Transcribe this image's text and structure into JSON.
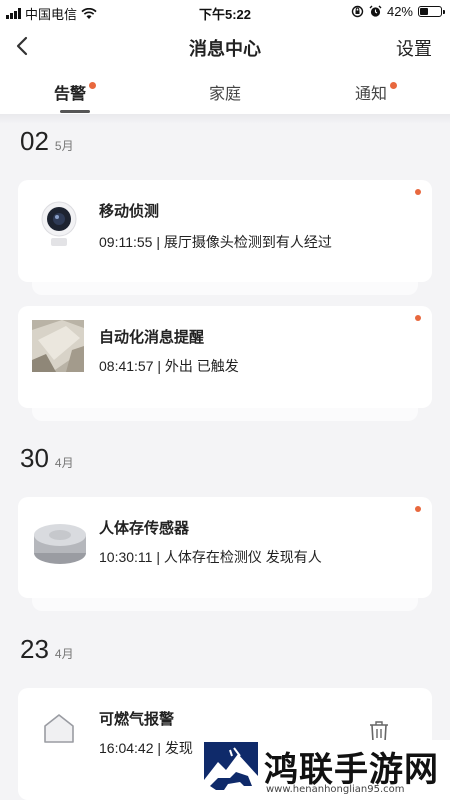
{
  "status_bar": {
    "carrier": "中国电信",
    "time": "下午5:22",
    "battery": "42%",
    "battery_level": 0.42,
    "icons": [
      "signal-icon",
      "wifi-icon",
      "orientation-lock-icon",
      "alarm-icon",
      "battery-icon"
    ]
  },
  "nav": {
    "title": "消息中心",
    "settings_label": "设置",
    "back_icon": "chevron-left-icon"
  },
  "tabs": [
    {
      "label": "告警",
      "active": true,
      "unread": true
    },
    {
      "label": "家庭",
      "active": false,
      "unread": false
    },
    {
      "label": "通知",
      "active": false,
      "unread": true
    }
  ],
  "groups": [
    {
      "day": "02",
      "month": "5月"
    },
    {
      "day": "30",
      "month": "4月"
    },
    {
      "day": "23",
      "month": "4月"
    }
  ],
  "messages": [
    {
      "title": "移动侦测",
      "detail": "09:11:55 | 展厅摄像头检测到有人经过",
      "thumb": "camera-icon",
      "unread": true
    },
    {
      "title": "自动化消息提醒",
      "detail": "08:41:57 | 外出 已触发",
      "thumb": "photo-thumbnail",
      "unread": true
    },
    {
      "title": "人体存传感器",
      "detail": "10:30:11 | 人体存在检测仪 发现有人",
      "thumb": "presence-sensor-icon",
      "unread": true
    },
    {
      "title": "可燃气报警",
      "detail": "16:04:42 | 发现",
      "thumb": "gas-sensor-icon",
      "unread": false,
      "action_icon": "trash-icon"
    }
  ],
  "watermark": {
    "title": "鸿联手游网",
    "url": "www.henanhonglian95.com"
  },
  "colors": {
    "accent": "#e8683e",
    "background": "#f4f4f6",
    "card": "#ffffff"
  }
}
